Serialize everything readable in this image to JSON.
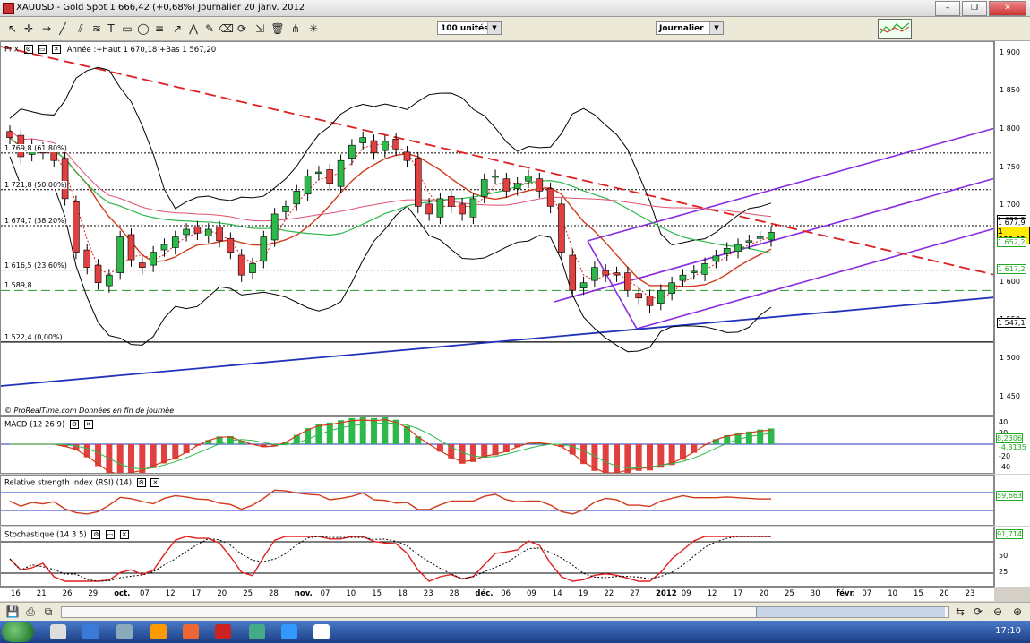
{
  "window": {
    "title": "XAUUSD - Gold Spot    1 666,42 (+0,68%)    Journalier  20 janv. 2012",
    "buttons": [
      "–",
      "❐",
      "✕"
    ]
  },
  "toolbar": {
    "units": "100 unités",
    "period": "Journalier"
  },
  "price_panel": {
    "title": "Prix",
    "legend": "Année :+Haut 1 670,18 +Bas 1 567,20",
    "source": "© ProRealTime.com  Données en fin de journée",
    "fib_labels": [
      "1 769,8 (61,80%)",
      "1 721,8 (50,00%)",
      "1 674,7 (38,20%)",
      "1 616,5 (23,60%)",
      "1 589,8",
      "1 522,4 (0,00%)"
    ],
    "y_ticks": [
      "1 900",
      "1 850",
      "1 800",
      "1 750",
      "1 700",
      "1 650",
      "1 600",
      "1 550",
      "1 500",
      "1 450"
    ],
    "right_labels": [
      "1 682,3",
      "1 677,9",
      "1 666,42",
      "1 652,2",
      "1 617,2",
      "1 547,1"
    ]
  },
  "macd_panel": {
    "title": "MACD (12 26 9)",
    "ticks": [
      "40",
      "20",
      "-20",
      "-40"
    ],
    "values": [
      "8,2306",
      "-4,3135"
    ]
  },
  "rsi_panel": {
    "title": "Relative strength index (RSI) (14)",
    "value": "59,663"
  },
  "stoch_panel": {
    "title": "Stochastique (14 3 5)",
    "ticks": [
      "50",
      "25"
    ],
    "value": "91,714"
  },
  "x_axis": [
    "16",
    "21",
    "26",
    "29",
    "oct.",
    "07",
    "12",
    "17",
    "20",
    "25",
    "28",
    "nov.",
    "07",
    "10",
    "15",
    "18",
    "23",
    "28",
    "déc.",
    "06",
    "09",
    "14",
    "19",
    "22",
    "27",
    "2012",
    "09",
    "12",
    "17",
    "20",
    "25",
    "30",
    "févr.",
    "07",
    "10",
    "15",
    "20",
    "23"
  ],
  "taskbar": {
    "clock": "17:10"
  },
  "colors": {
    "up": "#2db84a",
    "down": "#e04040",
    "regression": "#8a2be2",
    "trend": "#2233bb",
    "ma": "#d23a1a",
    "bands": "#000000"
  },
  "chart_data": {
    "type": "candlestick",
    "title": "XAUUSD - Gold Spot",
    "ylim": [
      1425,
      1915
    ],
    "x_labels": [
      "16",
      "21",
      "26",
      "29",
      "oct.",
      "07",
      "12",
      "17",
      "20",
      "25",
      "28",
      "nov.",
      "07",
      "10",
      "15",
      "18",
      "23",
      "28",
      "déc.",
      "06",
      "09",
      "14",
      "19",
      "22",
      "27",
      "2012",
      "09",
      "12",
      "17",
      "20"
    ],
    "close": [
      1790,
      1765,
      1780,
      1770,
      1760,
      1710,
      1640,
      1620,
      1600,
      1610,
      1660,
      1630,
      1620,
      1640,
      1650,
      1660,
      1670,
      1665,
      1670,
      1655,
      1640,
      1610,
      1625,
      1660,
      1690,
      1700,
      1720,
      1740,
      1745,
      1730,
      1760,
      1780,
      1790,
      1770,
      1785,
      1775,
      1760,
      1700,
      1690,
      1710,
      1700,
      1690,
      1710,
      1735,
      1740,
      1720,
      1730,
      1740,
      1720,
      1700,
      1640,
      1590,
      1600,
      1620,
      1610,
      1610,
      1590,
      1580,
      1570,
      1590,
      1600,
      1610,
      1615,
      1625,
      1635,
      1645,
      1650,
      1655,
      1660,
      1666
    ],
    "fib_levels": [
      1769.8,
      1721.8,
      1674.7,
      1616.5,
      1589.8,
      1522.4
    ]
  }
}
